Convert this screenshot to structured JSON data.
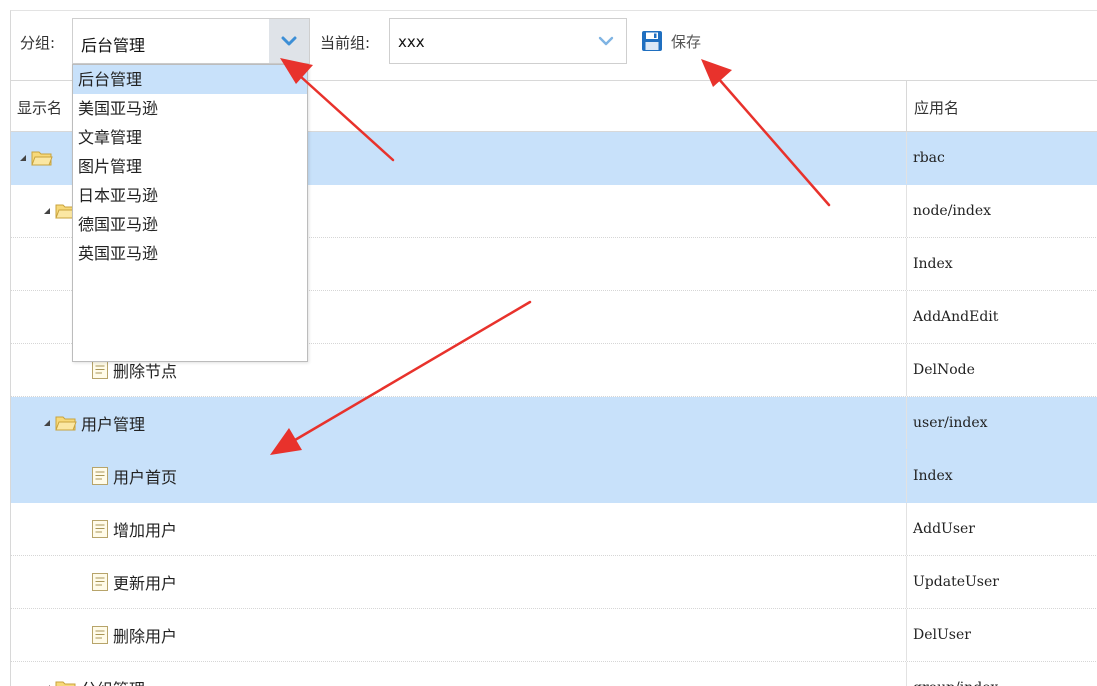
{
  "toolbar": {
    "group_label": "分组:",
    "group_value": "后台管理",
    "current_group_label": "当前组:",
    "current_group_value": "xxx",
    "save_label": "保存"
  },
  "dropdown": {
    "options": [
      "后台管理",
      "美国亚马逊",
      "文章管理",
      "图片管理",
      "日本亚马逊",
      "德国亚马逊",
      "英国亚马逊"
    ],
    "selected_index": 0
  },
  "grid": {
    "columns": {
      "name": "显示名",
      "app": "应用名"
    },
    "rows": [
      {
        "name": "",
        "app": "rbac",
        "type": "folder",
        "level": 0,
        "selected": true
      },
      {
        "name": "",
        "app": "node/index",
        "type": "folder",
        "level": 1,
        "selected": false
      },
      {
        "name": "",
        "app": "Index",
        "type": "file",
        "level": 2,
        "selected": false
      },
      {
        "name": "",
        "app": "AddAndEdit",
        "type": "file",
        "level": 2,
        "selected": false
      },
      {
        "name": "删除节点",
        "app": "DelNode",
        "type": "file",
        "level": 2,
        "selected": false
      },
      {
        "name": "用户管理",
        "app": "user/index",
        "type": "folder",
        "level": 1,
        "selected": true
      },
      {
        "name": "用户首页",
        "app": "Index",
        "type": "file",
        "level": 2,
        "selected": true
      },
      {
        "name": "增加用户",
        "app": "AddUser",
        "type": "file",
        "level": 2,
        "selected": false
      },
      {
        "name": "更新用户",
        "app": "UpdateUser",
        "type": "file",
        "level": 2,
        "selected": false
      },
      {
        "name": "删除用户",
        "app": "DelUser",
        "type": "file",
        "level": 2,
        "selected": false
      },
      {
        "name": "分组管理",
        "app": "group/index",
        "type": "folder",
        "level": 1,
        "selected": false
      }
    ]
  },
  "colors": {
    "selected_row": "#c8e1fa",
    "annotation_arrow": "#e8322c",
    "combo_arrow": "#3d8fd6",
    "save_icon": "#1f6fc0"
  },
  "icons": {
    "combo_arrow": "chevron-down-icon",
    "save": "floppy-disk-icon",
    "expand": "triangle-expanded-icon",
    "folder": "folder-open-icon",
    "file": "document-icon"
  }
}
